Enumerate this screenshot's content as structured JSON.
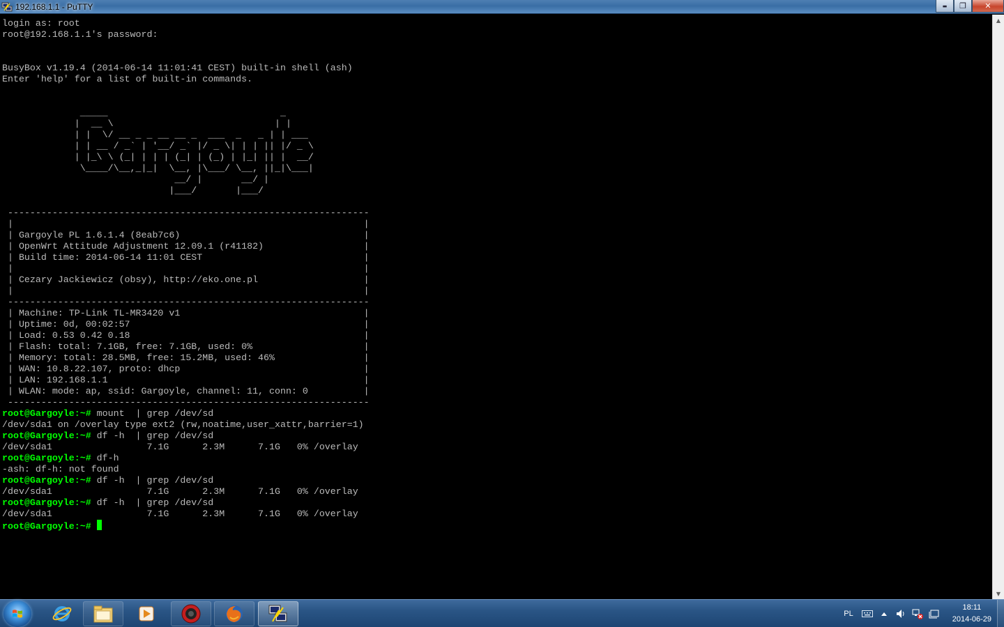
{
  "window": {
    "title": "192.168.1.1 - PuTTY",
    "minimize_glyph": "▬",
    "maximize_glyph": "❐",
    "close_glyph": "✕"
  },
  "terminal": {
    "colors": {
      "background": "#000000",
      "text": "#bbbbbb",
      "prompt": "#00ff00"
    },
    "lines": [
      {
        "text": "login as: root"
      },
      {
        "text": "root@192.168.1.1's password:"
      },
      {
        "text": ""
      },
      {
        "text": ""
      },
      {
        "text": "BusyBox v1.19.4 (2014-06-14 11:01:41 CEST) built-in shell (ash)"
      },
      {
        "text": "Enter 'help' for a list of built-in commands."
      },
      {
        "text": ""
      },
      {
        "text": ""
      },
      {
        "text": "              _____                               _"
      },
      {
        "text": "             |  __ \\                             | |"
      },
      {
        "text": "             | |  \\/ __ _ _ __ __ _  ___  _   _ | | ___"
      },
      {
        "text": "             | | __ / _` | '__/ _` |/ _ \\| | | || |/ _ \\"
      },
      {
        "text": "             | |_\\ \\ (_| | | | (_| | (_) | |_| || |  __/"
      },
      {
        "text": "              \\____/\\__,_|_|  \\__, |\\___/ \\__, ||_|\\___|"
      },
      {
        "text": "                               __/ |       __/ |"
      },
      {
        "text": "                              |___/       |___/"
      },
      {
        "text": ""
      },
      {
        "text": " -----------------------------------------------------------------"
      },
      {
        "text": " |                                                               |"
      },
      {
        "text": " | Gargoyle PL 1.6.1.4 (8eab7c6)                                 |"
      },
      {
        "text": " | OpenWrt Attitude Adjustment 12.09.1 (r41182)                  |"
      },
      {
        "text": " | Build time: 2014-06-14 11:01 CEST                             |"
      },
      {
        "text": " |                                                               |"
      },
      {
        "text": " | Cezary Jackiewicz (obsy), http://eko.one.pl                   |"
      },
      {
        "text": " |                                                               |"
      },
      {
        "text": " -----------------------------------------------------------------"
      },
      {
        "text": " | Machine: TP-Link TL-MR3420 v1                                 |"
      },
      {
        "text": " | Uptime: 0d, 00:02:57                                          |"
      },
      {
        "text": " | Load: 0.53 0.42 0.18                                          |"
      },
      {
        "text": " | Flash: total: 7.1GB, free: 7.1GB, used: 0%                    |"
      },
      {
        "text": " | Memory: total: 28.5MB, free: 15.2MB, used: 46%                |"
      },
      {
        "text": " | WAN: 10.8.22.107, proto: dhcp                                 |"
      },
      {
        "text": " | LAN: 192.168.1.1                                              |"
      },
      {
        "text": " | WLAN: mode: ap, ssid: Gargoyle, channel: 11, conn: 0          |"
      },
      {
        "text": " -----------------------------------------------------------------"
      },
      {
        "prompt": "root@Gargoyle:~#",
        "text": " mount  | grep /dev/sd"
      },
      {
        "text": "/dev/sda1 on /overlay type ext2 (rw,noatime,user_xattr,barrier=1)"
      },
      {
        "prompt": "root@Gargoyle:~#",
        "text": " df -h  | grep /dev/sd"
      },
      {
        "text": "/dev/sda1                 7.1G      2.3M      7.1G   0% /overlay"
      },
      {
        "prompt": "root@Gargoyle:~#",
        "text": " df-h"
      },
      {
        "text": "-ash: df-h: not found"
      },
      {
        "prompt": "root@Gargoyle:~#",
        "text": " df -h  | grep /dev/sd"
      },
      {
        "text": "/dev/sda1                 7.1G      2.3M      7.1G   0% /overlay"
      },
      {
        "prompt": "root@Gargoyle:~#",
        "text": " df -h  | grep /dev/sd"
      },
      {
        "text": "/dev/sda1                 7.1G      2.3M      7.1G   0% /overlay"
      },
      {
        "prompt": "root@Gargoyle:~#",
        "text": " ",
        "cursor": true
      }
    ]
  },
  "scrollbar": {
    "up_glyph": "▲",
    "down_glyph": "▼"
  },
  "taskbar": {
    "apps": [
      {
        "name": "internet-explorer",
        "icon": "ie-icon",
        "state": "normal"
      },
      {
        "name": "windows-explorer",
        "icon": "folder-icon",
        "state": "pinned"
      },
      {
        "name": "media-player",
        "icon": "media-play-icon",
        "state": "normal"
      },
      {
        "name": "recorder",
        "icon": "red-circle-app-icon",
        "state": "pinned"
      },
      {
        "name": "firefox",
        "icon": "firefox-icon",
        "state": "pinned"
      },
      {
        "name": "putty",
        "icon": "putty-icon",
        "state": "active"
      }
    ],
    "tray": {
      "language": "PL",
      "icons": [
        "keyboard-icon",
        "show-hidden-icons-arrow",
        "volume-icon",
        "network-error-icon",
        "action-center-icon"
      ],
      "time": "18:11",
      "date": "2014-06-29"
    }
  }
}
